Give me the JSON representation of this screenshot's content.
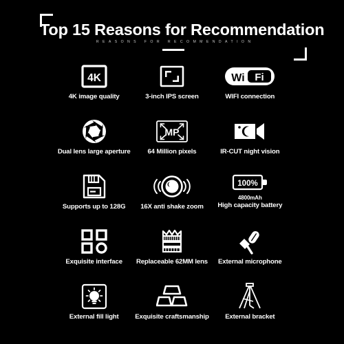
{
  "poster": {
    "background_color": "#000000",
    "foreground_color": "#ffffff",
    "header": {
      "title": "Top 15 Reasons for Recommendation",
      "subtitle": "REASONS FOR RECOMMENDATION"
    },
    "features": [
      {
        "icon": "4k-badge-icon",
        "label": "4K image quality",
        "sublabel": "",
        "badge_text": "4K"
      },
      {
        "icon": "screen-corners-icon",
        "label": "3-inch IPS screen",
        "sublabel": "",
        "badge_text": ""
      },
      {
        "icon": "wifi-pill-icon",
        "label": "WIFI connection",
        "sublabel": "",
        "badge_text": "WiFi",
        "badge_text_part1": "Wi",
        "badge_text_part2": "Fi"
      },
      {
        "icon": "aperture-icon",
        "label": "Dual lens large aperture",
        "sublabel": "",
        "badge_text": ""
      },
      {
        "icon": "megapixel-frame-icon",
        "label": "64 Million pixels",
        "sublabel": "",
        "badge_text": "MP"
      },
      {
        "icon": "night-vision-camcorder-icon",
        "label": "IR-CUT night vision",
        "sublabel": "",
        "badge_text": ""
      },
      {
        "icon": "memory-card-icon",
        "label": "Supports up to 128G",
        "sublabel": "",
        "badge_text": ""
      },
      {
        "icon": "anti-shake-lens-icon",
        "label": "16X anti shake zoom",
        "sublabel": "",
        "badge_text": ""
      },
      {
        "icon": "battery-icon",
        "label": "High capacity battery",
        "sublabel": "4800mAh",
        "badge_text": "100%"
      },
      {
        "icon": "interface-grid-icon",
        "label": "Exquisite interface",
        "sublabel": "",
        "badge_text": ""
      },
      {
        "icon": "lens-filter-icon",
        "label": "Replaceable 62MM lens",
        "sublabel": "",
        "badge_text": ""
      },
      {
        "icon": "microphone-icon",
        "label": "External microphone",
        "sublabel": "",
        "badge_text": ""
      },
      {
        "icon": "fill-light-bulb-icon",
        "label": "External fill light",
        "sublabel": "",
        "badge_text": ""
      },
      {
        "icon": "ingot-stack-icon",
        "label": "Exquisite craftsmanship",
        "sublabel": "",
        "badge_text": ""
      },
      {
        "icon": "tripod-icon",
        "label": "External bracket",
        "sublabel": "",
        "badge_text": ""
      }
    ]
  }
}
